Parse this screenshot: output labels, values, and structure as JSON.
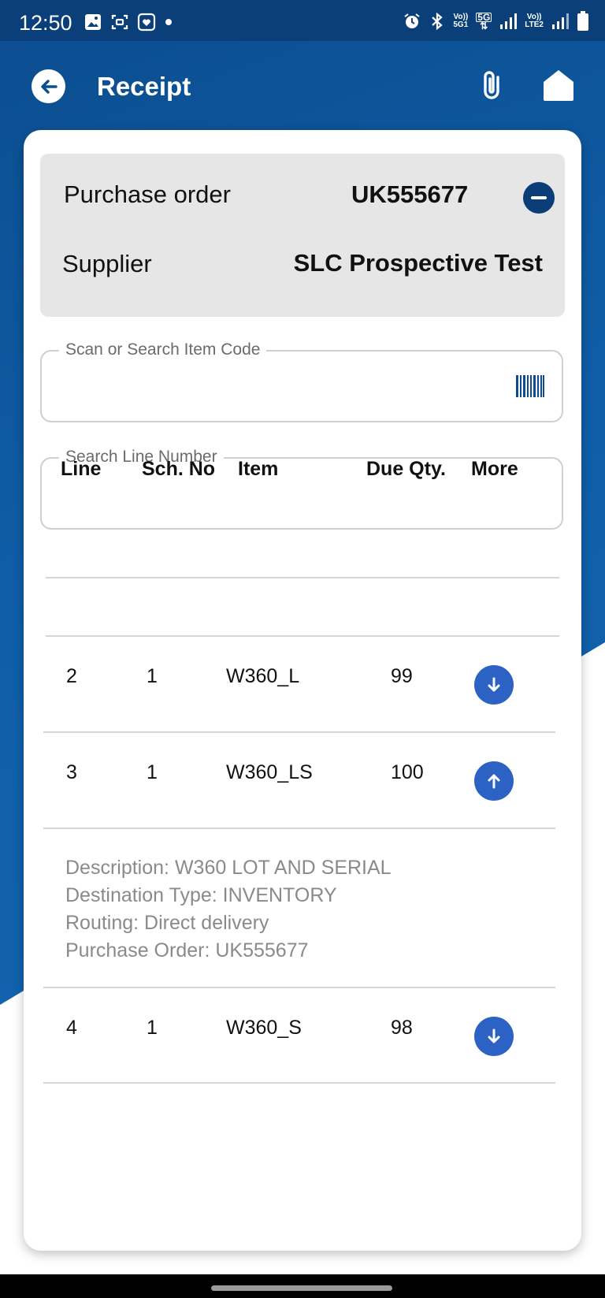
{
  "status_bar": {
    "time": "12:50",
    "left_icons": [
      "gallery-icon",
      "screenshot-icon",
      "heart-app-icon",
      "dot-icon"
    ],
    "right_icons": [
      "alarm-icon",
      "bluetooth-icon",
      "volte-5g-icon",
      "5g-data-icon",
      "signal-icon",
      "volte-lte2-icon",
      "signal-icon",
      "battery-icon"
    ],
    "vo_5g_line1": "Vo))",
    "vo_5g_line2": "5G1",
    "g5": "5G",
    "vo_lte_line1": "Vo))",
    "vo_lte_line2": "LTE2"
  },
  "app_bar": {
    "title": "Receipt",
    "back_icon": "arrow-left-icon",
    "attach_icon": "paperclip-icon",
    "home_icon": "home-icon"
  },
  "order": {
    "po_label": "Purchase order",
    "po_value": "UK555677",
    "supplier_label": "Supplier",
    "supplier_value": "SLC Prospective Test"
  },
  "search": {
    "item_code_label": "Scan or Search Item Code",
    "item_code_value": "",
    "line_number_label": "Search Line Number",
    "line_number_value": ""
  },
  "table": {
    "headers": {
      "line": "Line",
      "sch": "Sch. No",
      "item": "Item",
      "due": "Due Qty.",
      "more": "More"
    },
    "rows": [
      {
        "line": "2",
        "sch": "1",
        "item": "W360_L",
        "due": "99",
        "expanded": false
      },
      {
        "line": "3",
        "sch": "1",
        "item": "W360_LS",
        "due": "100",
        "expanded": true
      },
      {
        "line": "4",
        "sch": "1",
        "item": "W360_S",
        "due": "98",
        "expanded": false
      }
    ],
    "details": {
      "description": "Description: W360 LOT AND SERIAL",
      "destination": "Destination Type: INVENTORY",
      "routing": "Routing: Direct delivery",
      "purchase_order": "Purchase Order: UK555677"
    }
  },
  "colors": {
    "header_blue": "#0c4d8f",
    "status_blue": "#0a3f79",
    "button_blue": "#2b62c4",
    "collapse_navy": "#0b3e78"
  }
}
